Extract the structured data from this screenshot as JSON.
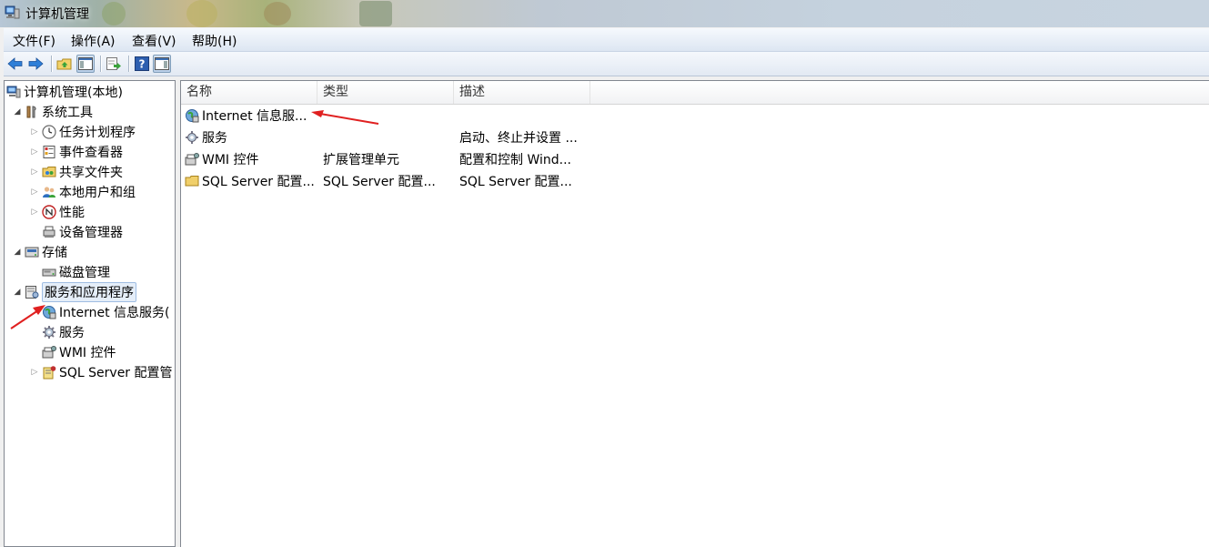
{
  "window": {
    "title": "计算机管理",
    "app_icon": "computer-management-icon"
  },
  "menu": {
    "items": [
      {
        "label": "文件(F)"
      },
      {
        "label": "操作(A)"
      },
      {
        "label": "查看(V)"
      },
      {
        "label": "帮助(H)"
      }
    ]
  },
  "toolbar": {
    "buttons": [
      {
        "icon": "back-arrow-icon"
      },
      {
        "icon": "forward-arrow-icon"
      },
      {
        "icon": "up-folder-icon"
      },
      {
        "icon": "show-console-tree-icon"
      },
      {
        "icon": "export-list-icon"
      },
      {
        "icon": "help-icon"
      },
      {
        "icon": "show-action-pane-icon"
      }
    ]
  },
  "tree": {
    "root": {
      "label": "计算机管理(本地)"
    },
    "items": [
      {
        "label": "系统工具",
        "icon": "tools-icon"
      },
      {
        "label": "任务计划程序",
        "icon": "clock-icon"
      },
      {
        "label": "事件查看器",
        "icon": "event-viewer-icon"
      },
      {
        "label": "共享文件夹",
        "icon": "shared-folder-icon"
      },
      {
        "label": "本地用户和组",
        "icon": "users-icon"
      },
      {
        "label": "性能",
        "icon": "performance-icon"
      },
      {
        "label": "设备管理器",
        "icon": "device-manager-icon"
      },
      {
        "label": "存储",
        "icon": "storage-icon"
      },
      {
        "label": "磁盘管理",
        "icon": "disk-icon"
      },
      {
        "label": "服务和应用程序",
        "icon": "services-apps-icon"
      },
      {
        "label": "Internet 信息服务(",
        "icon": "iis-icon"
      },
      {
        "label": "服务",
        "icon": "gear-icon"
      },
      {
        "label": "WMI 控件",
        "icon": "wmi-icon"
      },
      {
        "label": "SQL Server 配置管",
        "icon": "sql-server-icon"
      }
    ]
  },
  "list": {
    "columns": [
      "名称",
      "类型",
      "描述"
    ],
    "rows": [
      {
        "name": "Internet 信息服...",
        "type": "",
        "description": "",
        "icon": "iis-icon"
      },
      {
        "name": "服务",
        "type": "",
        "description": "启动、终止并设置 ...",
        "icon": "gear-icon"
      },
      {
        "name": "WMI 控件",
        "type": "扩展管理单元",
        "description": "配置和控制 Wind...",
        "icon": "wmi-icon"
      },
      {
        "name": "SQL Server 配置...",
        "type": "SQL Server 配置...",
        "description": "SQL Server 配置...",
        "icon": "folder-icon"
      }
    ]
  },
  "colors": {
    "annotation_arrow": "#e02020",
    "selection_bg": "#e5eef9",
    "selection_border": "#9fbde2"
  }
}
